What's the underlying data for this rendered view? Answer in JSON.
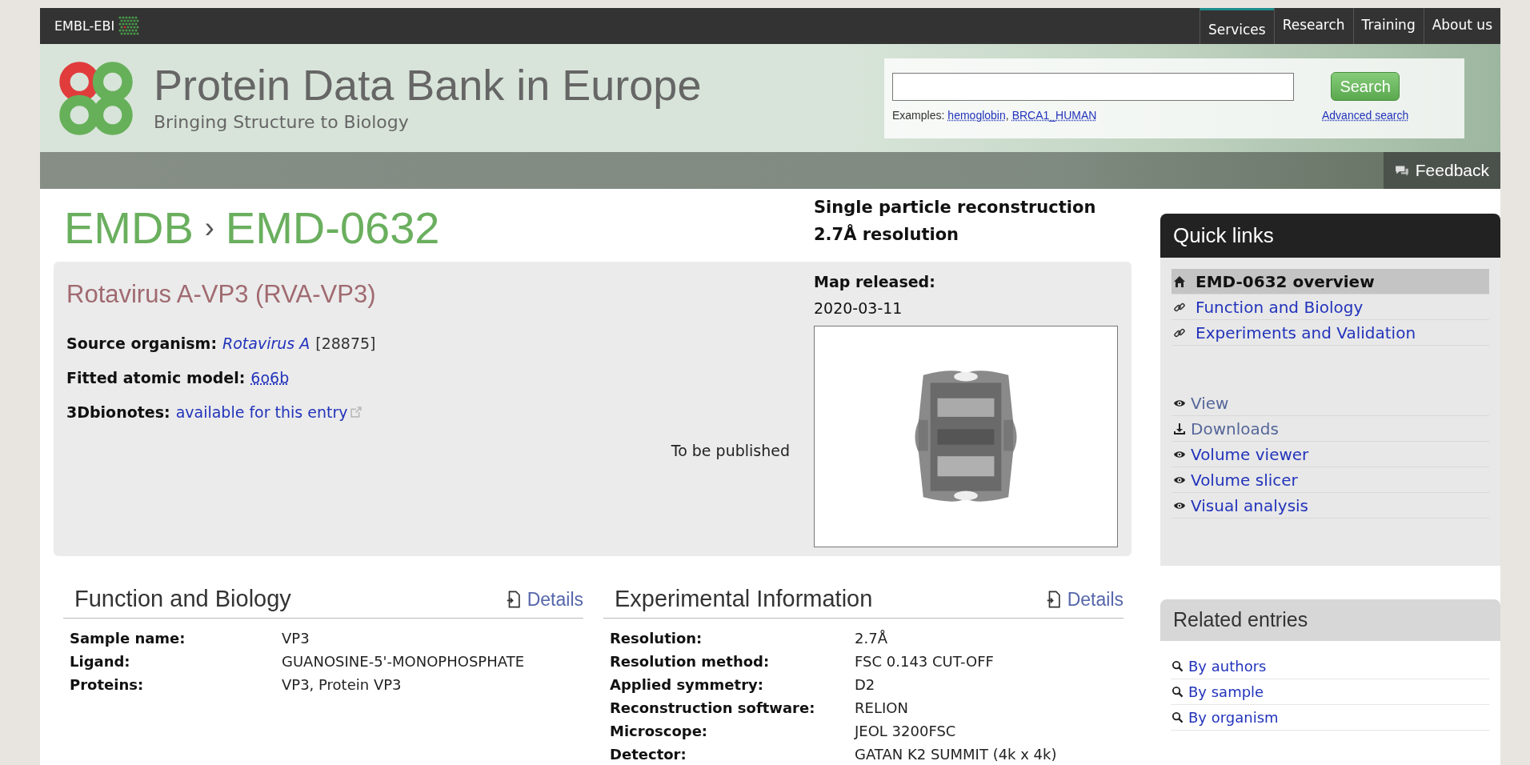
{
  "top_bar": {
    "brand": "EMBL-EBI",
    "nav": [
      {
        "label": "Services",
        "selected": true
      },
      {
        "label": "Research",
        "selected": false
      },
      {
        "label": "Training",
        "selected": false
      },
      {
        "label": "About us",
        "selected": false
      }
    ]
  },
  "header": {
    "title": "Protein Data Bank in Europe",
    "subtitle": "Bringing Structure to Biology",
    "search": {
      "examples_label": "Examples:",
      "examples": [
        "hemoglobin",
        "BRCA1_HUMAN"
      ],
      "examples_separator": ",",
      "button": "Search",
      "advanced": "Advanced search"
    },
    "feedback": "Feedback"
  },
  "breadcrumb": {
    "root": "EMDB",
    "separator": "›",
    "current": "EMD-0632"
  },
  "method": [
    "Single particle reconstruction",
    "2.7Å resolution"
  ],
  "entry": {
    "title": "Rotavirus A-VP3 (RVA-VP3)",
    "fields": [
      {
        "label": "Source organism:",
        "value": "Rotavirus A",
        "suffix": "[28875]",
        "kind": "species"
      },
      {
        "label": "Fitted atomic model:",
        "value": "6o6b",
        "kind": "model"
      },
      {
        "label": "3Dbionotes:",
        "value": "available for this entry",
        "kind": "external"
      }
    ],
    "publication": "To be published",
    "map": {
      "label": "Map released:",
      "date": "2020-03-11",
      "kind": "picture"
    }
  },
  "quick_links": {
    "title": "Quick links",
    "items": [
      {
        "label": "EMD-0632 overview",
        "kind": "home",
        "selected": true
      },
      {
        "label": "Function and Biology",
        "kind": "link",
        "selected": false
      },
      {
        "label": "Experiments and Validation",
        "kind": "link",
        "selected": false
      }
    ],
    "tools": [
      {
        "label": "View",
        "kind": "eye",
        "muted": true
      },
      {
        "label": "Downloads",
        "kind": "download",
        "muted": true
      },
      {
        "label": "Volume viewer",
        "kind": "eye",
        "muted": false
      },
      {
        "label": "Volume slicer",
        "kind": "eye",
        "muted": false
      },
      {
        "label": "Visual analysis",
        "kind": "eye",
        "muted": false
      }
    ]
  },
  "sections": [
    {
      "title": "Function and Biology",
      "details": "Details",
      "rows": [
        {
          "label": "Sample name:",
          "value": "VP3"
        },
        {
          "label": "Ligand:",
          "value": "GUANOSINE-5'-MONOPHOSPHATE"
        },
        {
          "label": "Proteins:",
          "value": "VP3, Protein VP3"
        }
      ]
    },
    {
      "title": "Experimental Information",
      "details": "Details",
      "rows": [
        {
          "label": "Resolution:",
          "value": "2.7Å"
        },
        {
          "label": "Resolution method:",
          "value": "FSC 0.143 CUT-OFF"
        },
        {
          "label": "Applied symmetry:",
          "value": "D2"
        },
        {
          "label": "Reconstruction software:",
          "value": "RELION"
        },
        {
          "label": "Microscope:",
          "value": "JEOL 3200FSC"
        },
        {
          "label": "Detector:",
          "value": "GATAN K2 SUMMIT (4k x 4k)"
        }
      ]
    }
  ],
  "related": {
    "title": "Related entries",
    "items": [
      "By authors",
      "By sample",
      "By organism"
    ]
  }
}
